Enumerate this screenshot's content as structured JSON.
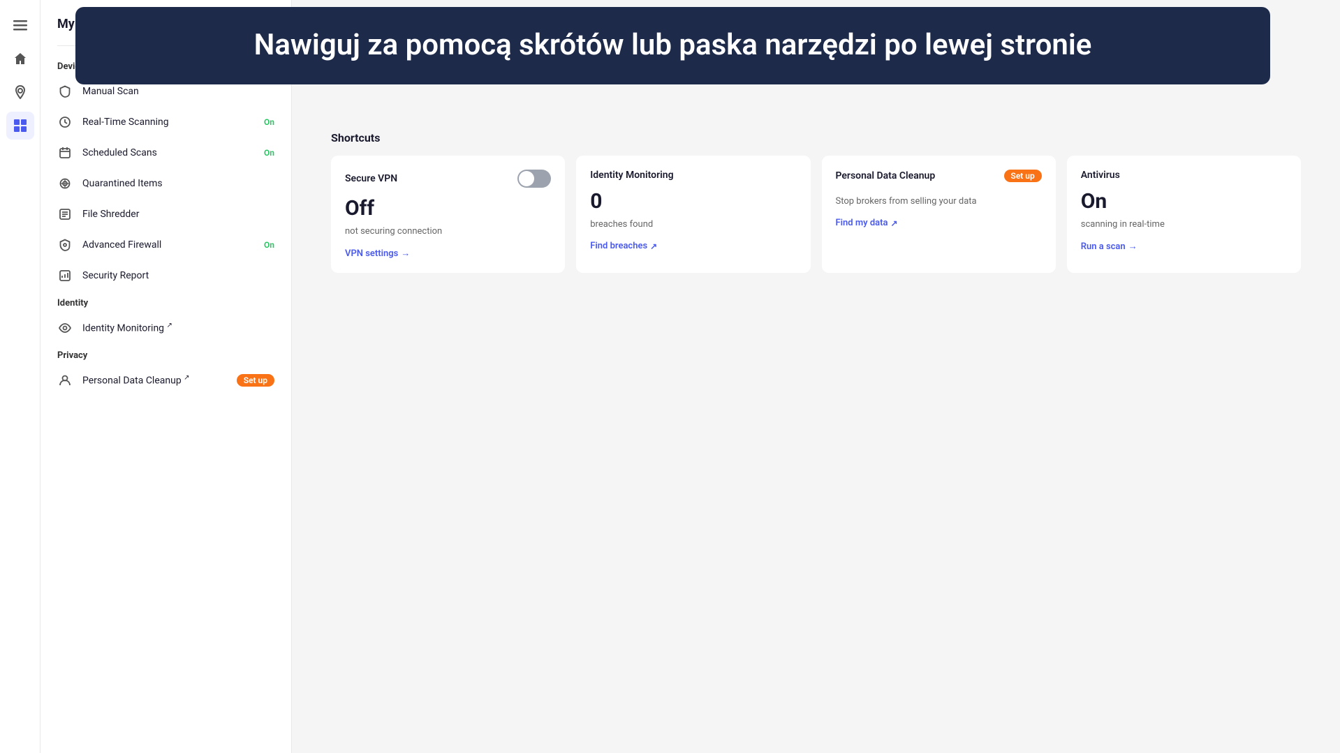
{
  "tooltip": {
    "text": "Nawiguj za pomocą skrótów lub paska narzędzi po lewej stronie"
  },
  "sidebar": {
    "title": "My Protection",
    "sections": {
      "device_label": "Device",
      "identity_label": "Identity",
      "privacy_label": "Privacy"
    },
    "device_items": [
      {
        "id": "manual-scan",
        "label": "Manual Scan",
        "badge": "",
        "icon": "shield"
      },
      {
        "id": "real-time-scanning",
        "label": "Real-Time Scanning",
        "badge": "On",
        "icon": "clock"
      },
      {
        "id": "scheduled-scans",
        "label": "Scheduled Scans",
        "badge": "On",
        "icon": "calendar"
      },
      {
        "id": "quarantined-items",
        "label": "Quarantined Items",
        "badge": "",
        "icon": "box"
      },
      {
        "id": "file-shredder",
        "label": "File Shredder",
        "badge": "",
        "icon": "scissors"
      },
      {
        "id": "advanced-firewall",
        "label": "Advanced Firewall",
        "badge": "On",
        "icon": "fire"
      },
      {
        "id": "security-report",
        "label": "Security Report",
        "badge": "",
        "icon": "chart"
      }
    ],
    "identity_items": [
      {
        "id": "identity-monitoring",
        "label": "Identity Monitoring",
        "badge": "",
        "external": true,
        "icon": "eye"
      }
    ],
    "privacy_items": [
      {
        "id": "personal-data-cleanup",
        "label": "Personal Data Cleanup",
        "badge": "Set up",
        "external": true,
        "icon": "user"
      }
    ]
  },
  "shortcuts": {
    "title": "Shortcuts",
    "cards": [
      {
        "id": "secure-vpn",
        "title": "Secure VPN",
        "has_toggle": true,
        "toggle_on": false,
        "value": "Off",
        "description": "not securing connection",
        "link_text": "VPN settings",
        "link_arrow": "→",
        "has_external": false,
        "setup_badge": ""
      },
      {
        "id": "identity-monitoring",
        "title": "Identity Monitoring",
        "has_toggle": false,
        "toggle_on": false,
        "value": "0",
        "description": "breaches found",
        "link_text": "Find breaches",
        "link_arrow": "↗",
        "has_external": true,
        "setup_badge": ""
      },
      {
        "id": "personal-data-cleanup",
        "title": "Personal Data Cleanup",
        "has_toggle": false,
        "toggle_on": false,
        "value": "",
        "description": "Stop brokers from selling your data",
        "link_text": "Find my data",
        "link_arrow": "↗",
        "has_external": true,
        "setup_badge": "Set up"
      },
      {
        "id": "antivirus",
        "title": "Antivirus",
        "has_toggle": false,
        "toggle_on": false,
        "value": "On",
        "description": "scanning in real-time",
        "link_text": "Run a scan",
        "link_arrow": "→",
        "has_external": false,
        "setup_badge": ""
      }
    ]
  },
  "icon_rail": {
    "items": [
      {
        "id": "menu",
        "icon": "≡",
        "active": false
      },
      {
        "id": "home",
        "icon": "⌂",
        "active": false
      },
      {
        "id": "location",
        "icon": "◎",
        "active": false
      },
      {
        "id": "grid",
        "icon": "⊞",
        "active": true
      }
    ]
  }
}
